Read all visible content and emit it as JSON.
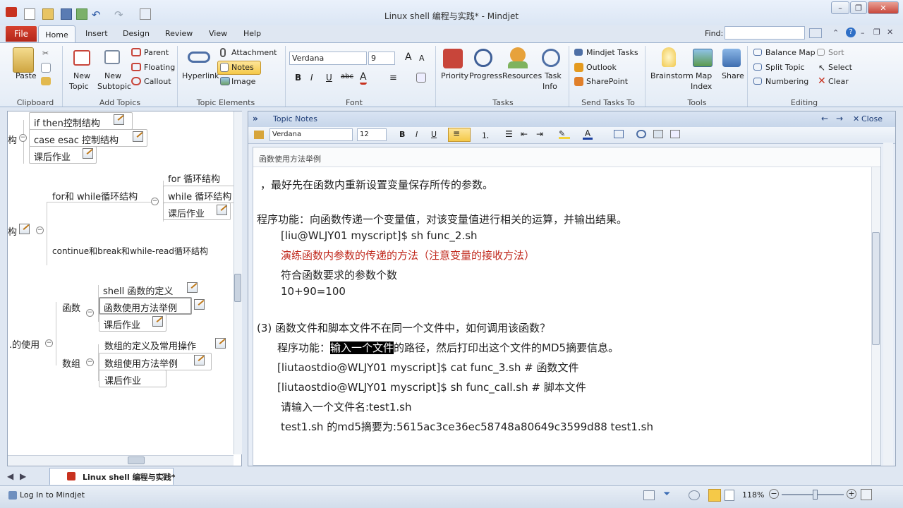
{
  "window": {
    "title": "Linux shell 编程与实践* - Mindjet"
  },
  "menu": {
    "file": "File",
    "tabs": [
      "Home",
      "Insert",
      "Design",
      "Review",
      "View",
      "Help"
    ],
    "find_label": "Find:"
  },
  "ribbon": {
    "clipboard": {
      "paste": "Paste",
      "group": "Clipboard"
    },
    "add_topics": {
      "new_topic": "New",
      "new_topic2": "Topic",
      "new_subtopic": "New",
      "new_subtopic2": "Subtopic",
      "parent": "Parent",
      "floating": "Floating",
      "callout": "Callout",
      "group": "Add Topics"
    },
    "topic_elements": {
      "hyperlink": "Hyperlink",
      "attachment": "Attachment",
      "notes": "Notes",
      "image": "Image",
      "group": "Topic Elements"
    },
    "font": {
      "family": "Verdana",
      "size": "9",
      "group": "Font"
    },
    "tasks": {
      "priority": "Priority",
      "progress": "Progress",
      "resources": "Resources",
      "task": "Task",
      "info": "Info",
      "group": "Tasks"
    },
    "send_tasks": {
      "mindjet_tasks": "Mindjet Tasks",
      "outlook": "Outlook",
      "sharepoint": "SharePoint",
      "group": "Send Tasks To"
    },
    "tools": {
      "brainstorm": "Brainstorm",
      "map": "Map",
      "index": "Index",
      "share": "Share",
      "group": "Tools"
    },
    "editing": {
      "balance_map": "Balance Map",
      "sort": "Sort",
      "split_topic": "Split Topic",
      "select": "Select",
      "numbering": "Numbering",
      "clear": "Clear",
      "group": "Editing"
    }
  },
  "mindmap": {
    "nodes": {
      "if_then": "if then控制结构",
      "case_esac": "case esac 控制结构",
      "homework1": "课后作业",
      "for_loop": "for 循环结构",
      "for_while": "for和 while循环结构",
      "while_loop": "while 循环结构",
      "homework2": "课后作业",
      "continue_break": "continue和break和while-read循环结构",
      "shell_func_def": "shell 函数的定义",
      "func_func": "函数",
      "func_usage": "函数使用方法举例",
      "homework3": "课后作业",
      "array_def": "数组的定义及常用操作",
      "array": "数组",
      "array_usage": "数组使用方法举例",
      "homework4": "课后作业",
      "left_gou1": "构",
      "left_gou2": "构",
      "left_usage": ".的使用"
    }
  },
  "notes": {
    "header": "Topic Notes",
    "close": "Close",
    "font": "Verdana",
    "size": "12",
    "topic_title": "函数使用方法举例",
    "lines": [
      "，最好先在函数内重新设置变量保存所传的参数。",
      "程序功能：向函数传递一个变量值，对该变量值进行相关的运算，并输出结果。",
      "[liu@WLJY01 myscript]$ sh func_2.sh",
      "演练函数内参数的传递的方法（注意变量的接收方法）",
      "符合函数要求的参数个数",
      "10+90=100",
      "(3) 函数文件和脚本文件不在同一个文件中，如何调用该函数？",
      "程序功能：",
      "输入一个文件",
      "的路径，然后打印出这个文件的MD5摘要信息。",
      "[liutaostdio@WLJY01 myscript]$ cat func_3.sh    # 函数文件",
      "[liutaostdio@WLJY01 myscript]$ sh func_call.sh    # 脚本文件",
      "请输入一个文件名:test1.sh",
      "test1.sh 的md5摘要为:5615ac3ce36ec58748a80649c3599d88  test1.sh"
    ]
  },
  "doc_tab": {
    "name": "Linux shell 编程与实践*"
  },
  "status": {
    "login": "Log In to Mindjet",
    "zoom": "118%"
  },
  "colors": {
    "accent_red": "#c0281c",
    "file_tab": "#c8321f",
    "selection": "#000000"
  }
}
